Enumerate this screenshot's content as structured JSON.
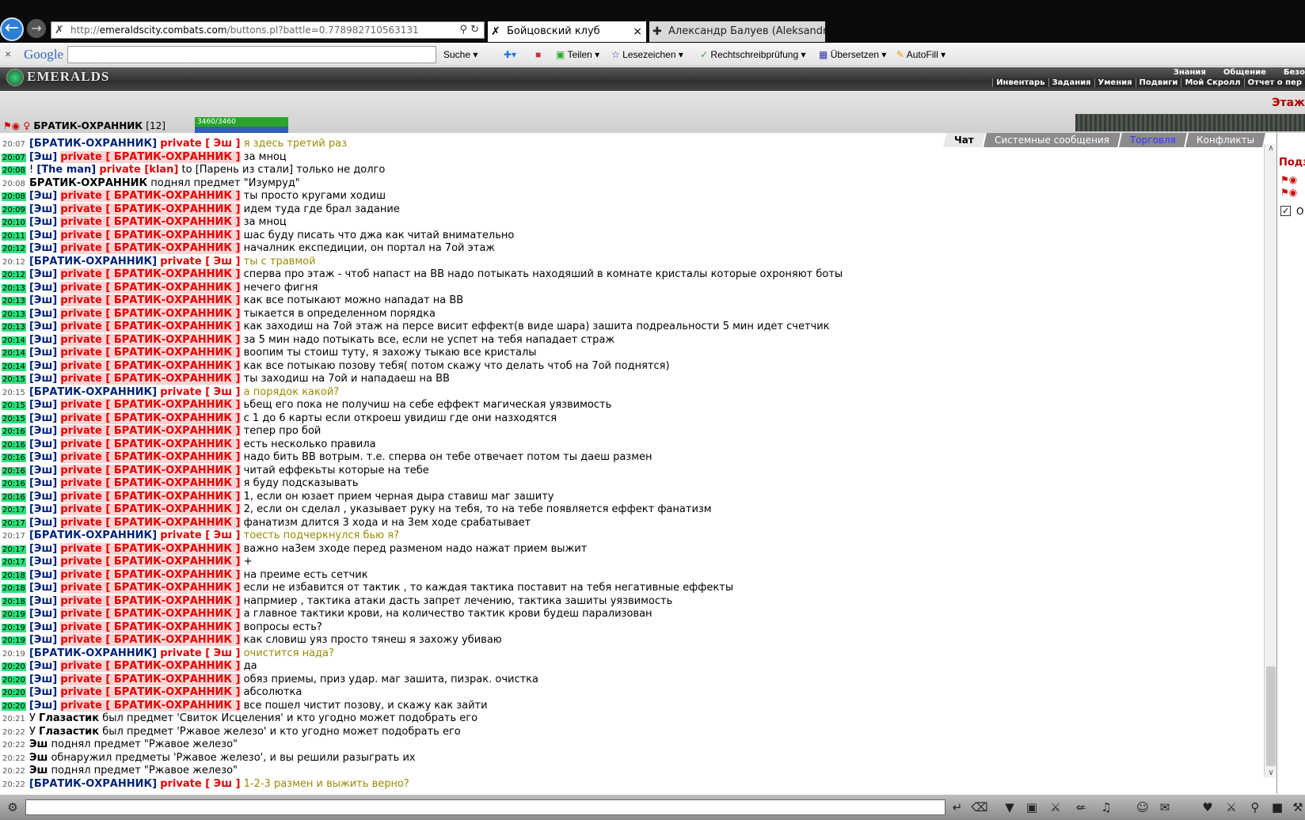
{
  "browser": {
    "url_prefix": "http://",
    "url_domain": "emeraldscity.combats.com",
    "url_path": "/buttons.pl?battle=0.778982710563131",
    "tabs": [
      {
        "label": "Бойцовский клуб"
      },
      {
        "label": "Александр Балуев (Aleksandr ..."
      }
    ]
  },
  "google_bar": {
    "logo": "Google",
    "items": [
      "Suche",
      "Teilen",
      "Lesezeichen",
      "Rechtschreibprüfung",
      "Übersetzen",
      "AutoFill"
    ]
  },
  "game": {
    "logo": "EMERALDS",
    "menu_top": [
      "Знания",
      "Общение",
      "Безо"
    ],
    "menu_bottom": [
      "Инвентарь",
      "Задания",
      "Умения",
      "Подвиги",
      "Мой Скролл",
      "Отчет о пер"
    ],
    "floor": "Этаж",
    "player": {
      "name": "БРАТИК-ОХРАННИК",
      "level": "[12]",
      "hp": "3460/3460"
    },
    "chat_tabs": [
      "Чат",
      "Системные сообщения",
      "Торговля",
      "Конфликты"
    ],
    "side_title": "Подз",
    "side_checkbox": "О"
  },
  "chat": [
    {
      "t": "20:07",
      "g": 0,
      "type": "p",
      "from": "БРАТИК-ОХРАННИК",
      "to": "Эш",
      "msg": "я здесь третий раз",
      "mine": true
    },
    {
      "t": "20:07",
      "g": 1,
      "type": "p",
      "from": "Эш",
      "to": "БРАТИК-ОХРАННИК",
      "msg": "за мноц"
    },
    {
      "t": "20:08",
      "g": 1,
      "type": "raw",
      "html": "! <span class='nmb'>[The man]</span> <span class='prv'>private [klan]</span> to [Парень из стали] только не долго"
    },
    {
      "t": "20:08",
      "g": 0,
      "type": "raw",
      "html": "<span class='bld'>БРАТИК-ОХРАННИК</span> поднял предмет \"Изумруд\""
    },
    {
      "t": "20:08",
      "g": 1,
      "type": "p",
      "from": "Эш",
      "to": "БРАТИК-ОХРАННИК",
      "msg": "ты просто кругами ходиш"
    },
    {
      "t": "20:09",
      "g": 1,
      "type": "p",
      "from": "Эш",
      "to": "БРАТИК-ОХРАННИК",
      "msg": "идем туда где брал задание"
    },
    {
      "t": "20:10",
      "g": 1,
      "type": "p",
      "from": "Эш",
      "to": "БРАТИК-ОХРАННИК",
      "msg": "за мноц"
    },
    {
      "t": "20:11",
      "g": 1,
      "type": "p",
      "from": "Эш",
      "to": "БРАТИК-ОХРАННИК",
      "msg": "шас буду писать что джа как читай внимательно"
    },
    {
      "t": "20:12",
      "g": 1,
      "type": "p",
      "from": "Эш",
      "to": "БРАТИК-ОХРАННИК",
      "msg": "началник експедиции, он портал на 7ой этаж"
    },
    {
      "t": "20:12",
      "g": 0,
      "type": "p",
      "from": "БРАТИК-ОХРАННИК",
      "to": "Эш",
      "msg": "ты с травмой",
      "mine": true
    },
    {
      "t": "20:12",
      "g": 1,
      "type": "p",
      "from": "Эш",
      "to": "БРАТИК-ОХРАННИК",
      "msg": "сперва про этаж - чтоб напаст на ВВ надо потыкать находяший в комнате кристалы которые охроняют боты"
    },
    {
      "t": "20:13",
      "g": 1,
      "type": "p",
      "from": "Эш",
      "to": "БРАТИК-ОХРАННИК",
      "msg": "нечего фигня"
    },
    {
      "t": "20:13",
      "g": 1,
      "type": "p",
      "from": "Эш",
      "to": "БРАТИК-ОХРАННИК",
      "msg": "как все потыкают можно нападат на ВВ"
    },
    {
      "t": "20:13",
      "g": 1,
      "type": "p",
      "from": "Эш",
      "to": "БРАТИК-ОХРАННИК",
      "msg": "тыкается в определенном порядка"
    },
    {
      "t": "20:13",
      "g": 1,
      "type": "p",
      "from": "Эш",
      "to": "БРАТИК-ОХРАННИК",
      "msg": "как заходиш на 7ой этаж на персе висит еффект(в виде шара) зашита подреальности 5 мин идет счетчик"
    },
    {
      "t": "20:14",
      "g": 1,
      "type": "p",
      "from": "Эш",
      "to": "БРАТИК-ОХРАННИК",
      "msg": "за 5 мин надо потыкать все, если не успет на тебя нападает страж"
    },
    {
      "t": "20:14",
      "g": 1,
      "type": "p",
      "from": "Эш",
      "to": "БРАТИК-ОХРАННИК",
      "msg": "воопим ты стоиш туту, я захожу тыкаю все кристалы"
    },
    {
      "t": "20:14",
      "g": 1,
      "type": "p",
      "from": "Эш",
      "to": "БРАТИК-ОХРАННИК",
      "msg": "как все потыкаю позову тебя( потом скажу что делать чтоб на 7ой поднятся)"
    },
    {
      "t": "20:15",
      "g": 1,
      "type": "p",
      "from": "Эш",
      "to": "БРАТИК-ОХРАННИК",
      "msg": "ты заходиш на 7ой и нападаеш на ВВ"
    },
    {
      "t": "20:15",
      "g": 0,
      "type": "p",
      "from": "БРАТИК-ОХРАННИК",
      "to": "Эш",
      "msg": "а порядок какой?",
      "mine": true
    },
    {
      "t": "20:15",
      "g": 1,
      "type": "p",
      "from": "Эш",
      "to": "БРАТИК-ОХРАННИК",
      "msg": "ьбещ его пока не получиш на себе еффект магическая уязвимость"
    },
    {
      "t": "20:15",
      "g": 1,
      "type": "p",
      "from": "Эш",
      "to": "БРАТИК-ОХРАННИК",
      "msg": "с 1 до 6 карты если откроеш увидиш где они назходятся"
    },
    {
      "t": "20:16",
      "g": 1,
      "type": "p",
      "from": "Эш",
      "to": "БРАТИК-ОХРАННИК",
      "msg": "тепер про бой"
    },
    {
      "t": "20:16",
      "g": 1,
      "type": "p",
      "from": "Эш",
      "to": "БРАТИК-ОХРАННИК",
      "msg": "есть несколько правила"
    },
    {
      "t": "20:16",
      "g": 1,
      "type": "p",
      "from": "Эш",
      "to": "БРАТИК-ОХРАННИК",
      "msg": "надо бить ВВ вотрым. т.е. сперва он тебе отвечает потом ты даеш размен"
    },
    {
      "t": "20:16",
      "g": 1,
      "type": "p",
      "from": "Эш",
      "to": "БРАТИК-ОХРАННИК",
      "msg": "читай еффекьты которые на тебе"
    },
    {
      "t": "20:16",
      "g": 1,
      "type": "p",
      "from": "Эш",
      "to": "БРАТИК-ОХРАННИК",
      "msg": "я буду подсказывать"
    },
    {
      "t": "20:16",
      "g": 1,
      "type": "p",
      "from": "Эш",
      "to": "БРАТИК-ОХРАННИК",
      "msg": "1, если он юзает прием черная дыра ставиш маг зашиту"
    },
    {
      "t": "20:17",
      "g": 1,
      "type": "p",
      "from": "Эш",
      "to": "БРАТИК-ОХРАННИК",
      "msg": "2, если он сделал , указывает руку на тебя, то на тебе появляется еффект фанатизм"
    },
    {
      "t": "20:17",
      "g": 1,
      "type": "p",
      "from": "Эш",
      "to": "БРАТИК-ОХРАННИК",
      "msg": "фанатизм длится 3 хода и на 3ем ходе срабатывает"
    },
    {
      "t": "20:17",
      "g": 0,
      "type": "p",
      "from": "БРАТИК-ОХРАННИК",
      "to": "Эш",
      "msg": "тоесть подчеркнулся бью я?",
      "mine": true
    },
    {
      "t": "20:17",
      "g": 1,
      "type": "p",
      "from": "Эш",
      "to": "БРАТИК-ОХРАННИК",
      "msg": "важно на3ем зходе перед разменом надо нажат прием выжит"
    },
    {
      "t": "20:17",
      "g": 1,
      "type": "p",
      "from": "Эш",
      "to": "БРАТИК-ОХРАННИК",
      "msg": "+"
    },
    {
      "t": "20:18",
      "g": 1,
      "type": "p",
      "from": "Эш",
      "to": "БРАТИК-ОХРАННИК",
      "msg": "на преиме есть сетчик"
    },
    {
      "t": "20:18",
      "g": 1,
      "type": "p",
      "from": "Эш",
      "to": "БРАТИК-ОХРАННИК",
      "msg": "если не избавится от тактик , то каждая тактика поставит на тебя негативные еффекты"
    },
    {
      "t": "20:18",
      "g": 1,
      "type": "p",
      "from": "Эш",
      "to": "БРАТИК-ОХРАННИК",
      "msg": "напрмиер , тактика атаки дасть запрет лечению, тактика зашиты уязвимость"
    },
    {
      "t": "20:19",
      "g": 1,
      "type": "p",
      "from": "Эш",
      "to": "БРАТИК-ОХРАННИК",
      "msg": "а главное тактики крови, на количество тактик крови будеш парализован"
    },
    {
      "t": "20:19",
      "g": 1,
      "type": "p",
      "from": "Эш",
      "to": "БРАТИК-ОХРАННИК",
      "msg": "вопросы есть?"
    },
    {
      "t": "20:19",
      "g": 1,
      "type": "p",
      "from": "Эш",
      "to": "БРАТИК-ОХРАННИК",
      "msg": "как словиш уяз просто тянеш я захожу убиваю"
    },
    {
      "t": "20:19",
      "g": 0,
      "type": "p",
      "from": "БРАТИК-ОХРАННИК",
      "to": "Эш",
      "msg": "очистится нада?",
      "mine": true
    },
    {
      "t": "20:20",
      "g": 1,
      "type": "p",
      "from": "Эш",
      "to": "БРАТИК-ОХРАННИК",
      "msg": "да"
    },
    {
      "t": "20:20",
      "g": 1,
      "type": "p",
      "from": "Эш",
      "to": "БРАТИК-ОХРАННИК",
      "msg": "обяз приемы, приз удар. маг зашита, пизрак. очистка"
    },
    {
      "t": "20:20",
      "g": 1,
      "type": "p",
      "from": "Эш",
      "to": "БРАТИК-ОХРАННИК",
      "msg": "абсолютка"
    },
    {
      "t": "20:20",
      "g": 1,
      "type": "p",
      "from": "Эш",
      "to": "БРАТИК-ОХРАННИК",
      "msg": "все пошел чистит позову, и скажу как зайти"
    },
    {
      "t": "20:21",
      "g": 0,
      "type": "raw",
      "html": "У <span class='bld'>Глазастик</span> был предмет 'Свиток Исцеления' и кто угодно может подобрать его"
    },
    {
      "t": "20:22",
      "g": 0,
      "type": "raw",
      "html": "У <span class='bld'>Глазастик</span> был предмет 'Ржавое железо' и кто угодно может подобрать его"
    },
    {
      "t": "20:22",
      "g": 0,
      "type": "raw",
      "html": "<span class='bld'>Эш</span> поднял предмет \"Ржавое железо\""
    },
    {
      "t": "20:22",
      "g": 0,
      "type": "raw",
      "html": "<span class='bld'>Эш</span> обнаружил предметы 'Ржавое железо', и вы решили разыграть их"
    },
    {
      "t": "20:22",
      "g": 0,
      "type": "raw",
      "html": "<span class='bld'>Эш</span> поднял предмет \"Ржавое железо\""
    },
    {
      "t": "20:22",
      "g": 0,
      "type": "p",
      "from": "БРАТИК-ОХРАННИК",
      "to": "Эш",
      "msg": "1-2-3 размен и выжить верно?",
      "mine": true
    }
  ]
}
